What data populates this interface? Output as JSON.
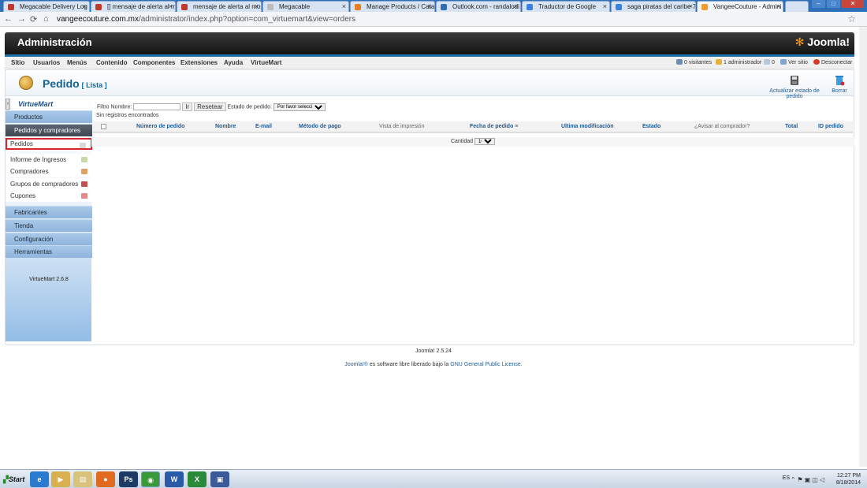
{
  "browser": {
    "tabs": [
      {
        "label": "Megacable Delivery Log",
        "color": "#c0392b"
      },
      {
        "label": "[] mensaje de alerta al mo",
        "color": "#c0392b"
      },
      {
        "label": "mensaje de alerta al mos",
        "color": "#c0392b"
      },
      {
        "label": "Megacable",
        "color": "#bbbbbb"
      },
      {
        "label": "Manage Products / Catalo",
        "color": "#e67e22"
      },
      {
        "label": "Outlook.com - randalodi",
        "color": "#2d6db5"
      },
      {
        "label": "Traductor de Google",
        "color": "#3b82e0"
      },
      {
        "label": "saga piratas del caribe 720",
        "color": "#3b82e0"
      },
      {
        "label": "VangeeCouture - Admini",
        "color": "#f29a2a"
      }
    ],
    "url_host": "vangeecouture.com.mx",
    "url_path": "/administrator/index.php?option=com_virtuemart&view=orders"
  },
  "header": {
    "title": "Administración",
    "logo": "Joomla!"
  },
  "menu": {
    "items": [
      "Sitio",
      "Usuarios",
      "Menús",
      "Contenido",
      "Componentes",
      "Extensiones",
      "Ayuda",
      "VirtueMart"
    ],
    "status": {
      "visitors": "0 visitantes",
      "admins": "1 administrador",
      "messages": "0",
      "view_site": "Ver sitio",
      "logout": "Desconectar"
    }
  },
  "page": {
    "title": "Pedido",
    "subtitle": "[ Lista ]",
    "toolbar": {
      "update_status": "Actualizar estado de pedido",
      "delete": "Borrar"
    }
  },
  "sidebar": {
    "logo": "VirtueMart",
    "sections": [
      "Productos",
      "Pedidos y compradores"
    ],
    "sub_items": [
      {
        "label": "Pedidos",
        "icon_color": "#d8d8d8"
      },
      {
        "label": "Informe de Ingresos",
        "icon_color": "#c9d6a8"
      },
      {
        "label": "Compradores",
        "icon_color": "#e0a060"
      },
      {
        "label": "Grupos de compradores",
        "icon_color": "#c25050"
      },
      {
        "label": "Cupones",
        "icon_color": "#e08a8a"
      }
    ],
    "sections_bottom": [
      "Fabricantes",
      "Tienda",
      "Configuración",
      "Herramientas"
    ],
    "version": "VirtueMart 2.6.8"
  },
  "filters": {
    "name_label": "Filtro Nombre:",
    "go": "Ir",
    "reset": "Resetear",
    "status_label": "Estado de pedido:",
    "status_selected": "Por favor seleccione"
  },
  "table": {
    "empty_message": "Sin registros encontrados",
    "columns": [
      "Número de pedido",
      "Nombre",
      "E-mail",
      "Método de pago",
      "Vista de impresión",
      "Fecha de pedido",
      "Ultima modificación",
      "Estado",
      "¿Avisar al comprador?",
      "Total",
      "ID pedido"
    ]
  },
  "pager": {
    "label": "Cantidad",
    "value": "10"
  },
  "footer": {
    "version": "Joomla! 2.5.24",
    "license_prefix": "Joomla!®",
    "license_text": " es software libre liberado bajo la ",
    "license_link": "GNU General Public License."
  },
  "taskbar": {
    "start": "Start",
    "lang": "ES",
    "time": "12:27 PM",
    "date": "8/18/2014"
  }
}
